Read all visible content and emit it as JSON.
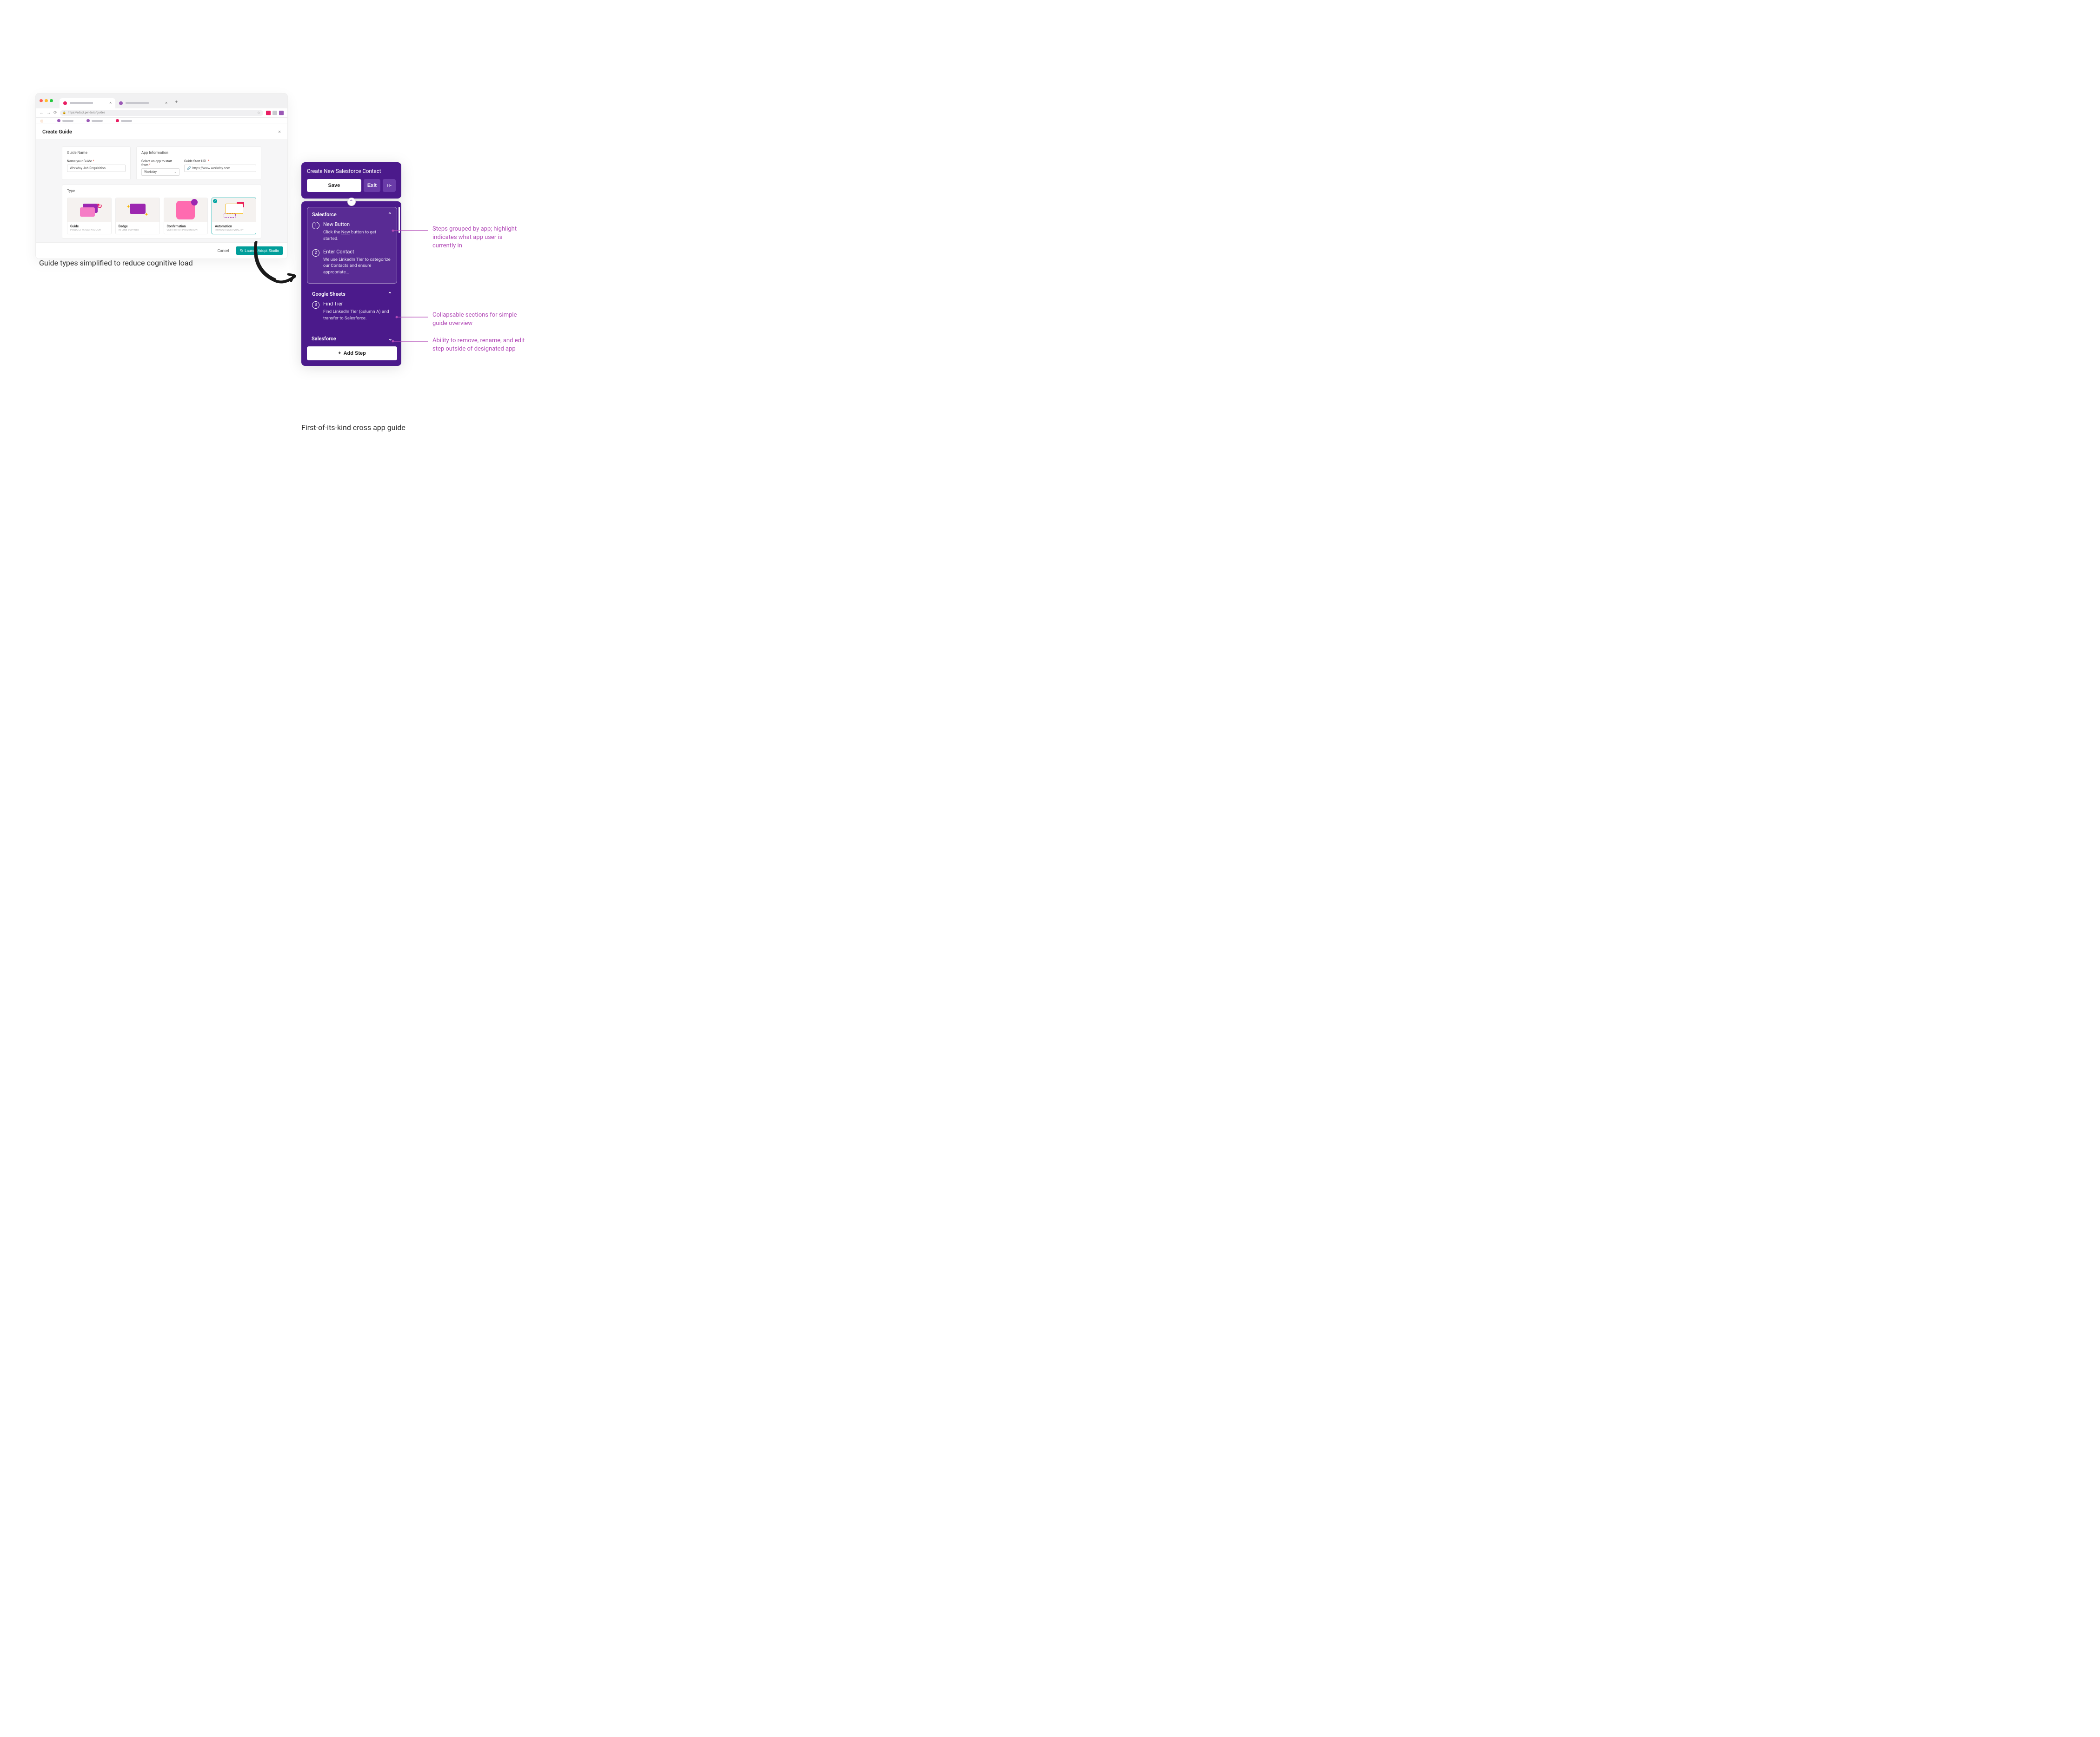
{
  "browser": {
    "url": "https://adopt.pendo.io/guides"
  },
  "modal": {
    "title": "Create Guide",
    "guide_name_section": "Guide Name",
    "guide_name_label": "Name your Guide",
    "guide_name_value": "Workday Job Requisition",
    "app_info_section": "App Information",
    "app_select_label": "Select an app to start from",
    "app_select_value": "Workday",
    "start_url_label": "Guide Start URL",
    "start_url_value": "https://www.workday.com",
    "type_section": "Type",
    "tiles": [
      {
        "name": "Guide",
        "sub": "PRODUCT WALKTHROUGH"
      },
      {
        "name": "Badge",
        "sub": "IN-LINE SUPPORT"
      },
      {
        "name": "Confirmation",
        "sub": "USER ERROR PREVENTION"
      },
      {
        "name": "Automation",
        "sub": "IMPROVE DATA QUALITY"
      }
    ],
    "cancel": "Cancel",
    "launch": "Launch Adopt Studio"
  },
  "caption_left": "Guide types simplified to reduce cognitive load",
  "panel": {
    "title": "Create New Salesforce Contact",
    "save": "Save",
    "exit": "Exit",
    "sections": [
      {
        "app": "Salesforce",
        "expanded": true,
        "active": true,
        "steps": [
          {
            "num": "1",
            "title": "New Button",
            "desc_pre": "Click the ",
            "desc_underline": "New",
            "desc_post": " button to get started."
          },
          {
            "num": "2",
            "title": "Enter Contact",
            "desc": "We use LinkedIn Tier to categorize our Contacts and ensure appropriate..."
          }
        ]
      },
      {
        "app": "Google Sheets",
        "expanded": true,
        "active": false,
        "steps": [
          {
            "num": "3",
            "title": "Find Tier",
            "desc": "Find LinkedIn Tier (column A) and transfer to Salesforce."
          }
        ]
      },
      {
        "app": "Salesforce",
        "expanded": false
      }
    ],
    "add_step": "Add Step"
  },
  "caption_right": "First-of-its-kind cross app guide",
  "annotations": {
    "a1": "Steps grouped by app; highlight indicates what app user is currently in",
    "a2": "Collapsable sections for simple guide overview",
    "a3": "Ability to remove, rename, and edit step outside of designated app"
  }
}
